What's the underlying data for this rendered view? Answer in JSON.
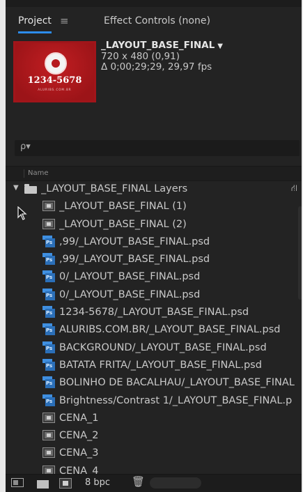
{
  "tabs": {
    "project": "Project",
    "project_menu": "≡",
    "effect_controls": "Effect Controls (none)"
  },
  "thumbnail": {
    "number": "1234-5678",
    "small_text": "ALURIBS.COM.BR",
    "bg_color": "#a1151a"
  },
  "selected_item": {
    "name": "_LAYOUT_BASE_FINAL",
    "caret": "▼",
    "dimensions": "720 x 480 (0,91)",
    "duration": "Δ 0;00;29;29, 29,97 fps"
  },
  "search": {
    "icon": "ρ▾"
  },
  "columns": {
    "name": "Name"
  },
  "folder": {
    "twirl": "▼",
    "label": "_LAYOUT_BASE_FINAL Layers",
    "flow_icon": "⛙"
  },
  "items": [
    {
      "type": "comp",
      "label": "_LAYOUT_BASE_FINAL (1)"
    },
    {
      "type": "comp",
      "label": "_LAYOUT_BASE_FINAL (2)"
    },
    {
      "type": "psd",
      "label": ",99/_LAYOUT_BASE_FINAL.psd"
    },
    {
      "type": "psd",
      "label": ",99/_LAYOUT_BASE_FINAL.psd"
    },
    {
      "type": "psd",
      "label": "0/_LAYOUT_BASE_FINAL.psd"
    },
    {
      "type": "psd",
      "label": "0/_LAYOUT_BASE_FINAL.psd"
    },
    {
      "type": "psd",
      "label": "1234-5678/_LAYOUT_BASE_FINAL.psd"
    },
    {
      "type": "psd",
      "label": "ALURIBS.COM.BR/_LAYOUT_BASE_FINAL.psd"
    },
    {
      "type": "psd",
      "label": "BACKGROUND/_LAYOUT_BASE_FINAL.psd"
    },
    {
      "type": "psd",
      "label": "BATATA FRITA/_LAYOUT_BASE_FINAL.psd"
    },
    {
      "type": "psd",
      "label": "BOLINHO DE BACALHAU/_LAYOUT_BASE_FINAL"
    },
    {
      "type": "psd",
      "label": "Brightness/Contrast 1/_LAYOUT_BASE_FINAL.p"
    },
    {
      "type": "comp",
      "label": "CENA_1"
    },
    {
      "type": "comp",
      "label": "CENA_2"
    },
    {
      "type": "comp",
      "label": "CENA_3"
    },
    {
      "type": "comp",
      "label": "CENA_4"
    }
  ],
  "bottom": {
    "bpc": "8 bpc",
    "trash_icon": "🗑"
  },
  "colors": {
    "panel_bg": "#232323",
    "accent_tab": "#2d8ceb",
    "psd_blue": "#2b6fb8"
  }
}
